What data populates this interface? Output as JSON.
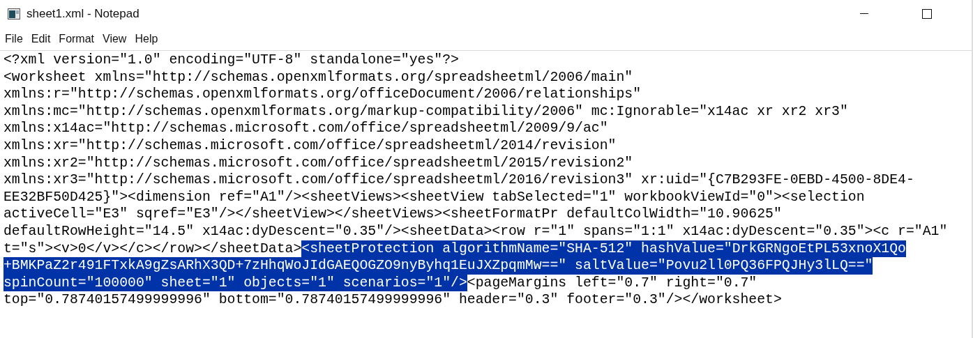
{
  "window": {
    "title": "sheet1.xml - Notepad"
  },
  "menu": [
    "File",
    "Edit",
    "Format",
    "View",
    "Help"
  ],
  "editor": {
    "lines": [
      [
        {
          "text": "<?xml version=\"1.0\" encoding=\"UTF-8\" standalone=\"yes\"?>",
          "selected": false
        }
      ],
      [
        {
          "text": "<worksheet xmlns=\"http://schemas.openxmlformats.org/spreadsheetml/2006/main\"",
          "selected": false
        }
      ],
      [
        {
          "text": "xmlns:r=\"http://schemas.openxmlformats.org/officeDocument/2006/relationships\"",
          "selected": false
        }
      ],
      [
        {
          "text": "xmlns:mc=\"http://schemas.openxmlformats.org/markup-compatibility/2006\" mc:Ignorable=\"x14ac xr xr2 xr3\"",
          "selected": false
        }
      ],
      [
        {
          "text": "xmlns:x14ac=\"http://schemas.microsoft.com/office/spreadsheetml/2009/9/ac\"",
          "selected": false
        }
      ],
      [
        {
          "text": "xmlns:xr=\"http://schemas.microsoft.com/office/spreadsheetml/2014/revision\"",
          "selected": false
        }
      ],
      [
        {
          "text": "xmlns:xr2=\"http://schemas.microsoft.com/office/spreadsheetml/2015/revision2\"",
          "selected": false
        }
      ],
      [
        {
          "text": "xmlns:xr3=\"http://schemas.microsoft.com/office/spreadsheetml/2016/revision3\" xr:uid=\"{C7B293FE-0EBD-4500-8DE4-",
          "selected": false
        }
      ],
      [
        {
          "text": "EE32BF50D425}\"><dimension ref=\"A1\"/><sheetViews><sheetView tabSelected=\"1\" workbookViewId=\"0\"><selection",
          "selected": false
        }
      ],
      [
        {
          "text": "activeCell=\"E3\" sqref=\"E3\"/></sheetView></sheetViews><sheetFormatPr defaultColWidth=\"10.90625\"",
          "selected": false
        }
      ],
      [
        {
          "text": "defaultRowHeight=\"14.5\" x14ac:dyDescent=\"0.35\"/><sheetData><row r=\"1\" spans=\"1:1\" x14ac:dyDescent=\"0.35\"><c r=\"A1\"",
          "selected": false
        }
      ],
      [
        {
          "text": "t=\"s\"><v>0</v></c></row></sheetData>",
          "selected": false
        },
        {
          "text": "<sheetProtection algorithmName=\"SHA-512\" hashValue=\"DrkGRNgoEtPL53xnoX1Qo",
          "selected": true
        }
      ],
      [
        {
          "text": "+BMKPaZ2r491FTxkA9gZsARhX3QD+7zHhqWoJIdGAEQOGZO9nyByhq1EuJXZpqmMw==\" saltValue=\"Povu2ll0PQ36FPQJHy3lLQ==\"",
          "selected": true
        }
      ],
      [
        {
          "text": "spinCount=\"100000\" sheet=\"1\" objects=\"1\" scenarios=\"1\"/>",
          "selected": true
        },
        {
          "text": "<pageMargins left=\"0.7\" right=\"0.7\"",
          "selected": false
        }
      ],
      [
        {
          "text": "top=\"0.78740157499999996\" bottom=\"0.78740157499999996\" header=\"0.3\" footer=\"0.3\"/></worksheet>",
          "selected": false
        }
      ]
    ]
  }
}
